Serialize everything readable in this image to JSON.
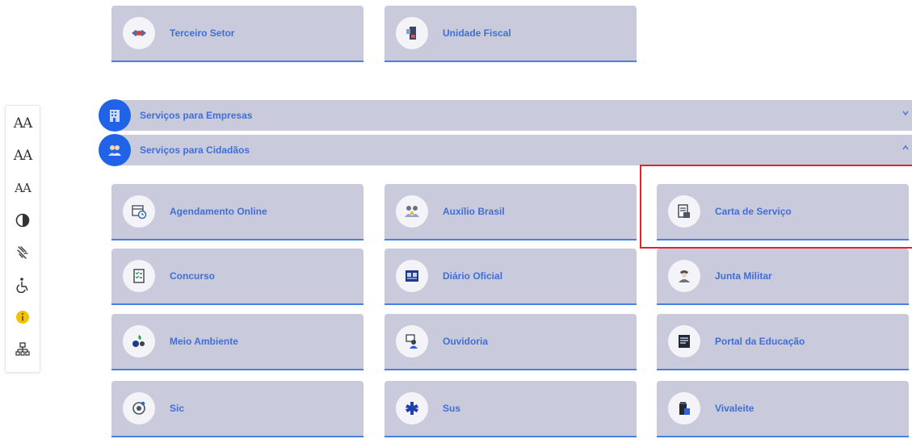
{
  "accessibility_toolbar": {
    "increase_font": "AA",
    "default_font": "AA",
    "decrease_font": "AA",
    "contrast_icon": "contrast-icon",
    "sign_language_icon": "sign-language-icon",
    "accessibility_icon": "wheelchair-icon",
    "info_icon": "info-icon",
    "sitemap_icon": "sitemap-icon"
  },
  "top_cards": [
    {
      "label": "Terceiro Setor",
      "icon": "handshake-icon"
    },
    {
      "label": "Unidade Fiscal",
      "icon": "fiscal-icon"
    }
  ],
  "accordions": [
    {
      "label": "Serviços para Empresas",
      "icon": "building-icon",
      "state": "collapsed"
    },
    {
      "label": "Serviços para Cidadãos",
      "icon": "people-icon",
      "state": "expanded"
    }
  ],
  "service_cards": [
    {
      "label": "Agendamento Online",
      "icon": "calendar-icon"
    },
    {
      "label": "Auxílio Brasil",
      "icon": "family-icon"
    },
    {
      "label": "Carta de Serviço",
      "icon": "document-icon"
    },
    {
      "label": "Concurso",
      "icon": "checklist-icon"
    },
    {
      "label": "Diário Oficial",
      "icon": "newspaper-icon"
    },
    {
      "label": "Junta Militar",
      "icon": "soldier-icon"
    },
    {
      "label": "Meio Ambiente",
      "icon": "nature-icon"
    },
    {
      "label": "Ouvidoria",
      "icon": "ombudsman-icon"
    },
    {
      "label": "Portal da Educação",
      "icon": "education-icon"
    },
    {
      "label": "Sic",
      "icon": "info-access-icon"
    },
    {
      "label": "Sus",
      "icon": "health-icon"
    },
    {
      "label": "Vivaleite",
      "icon": "milk-icon"
    }
  ],
  "colors": {
    "card_bg": "#c9cbdc",
    "accent": "#3f6fd6",
    "bubble": "#1f63e6",
    "highlight": "#e0262b"
  }
}
